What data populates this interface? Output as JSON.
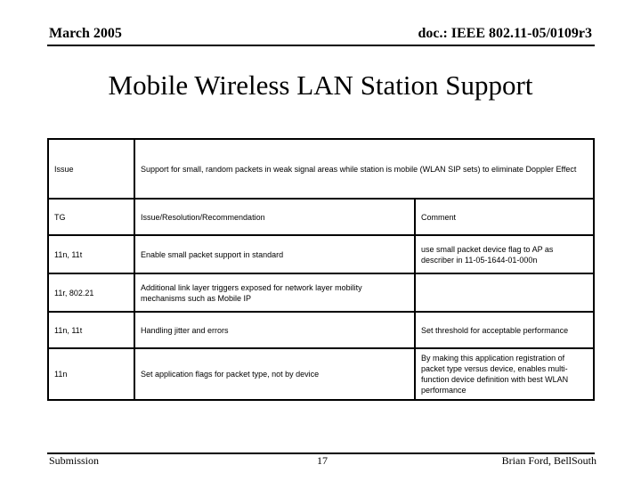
{
  "header": {
    "date": "March 2005",
    "doc_id": "doc.: IEEE 802.11-05/0109r3"
  },
  "title": "Mobile Wireless LAN Station Support",
  "table": {
    "issue_label": "Issue",
    "issue_text": "Support for small, random packets in weak signal areas while station is mobile (WLAN SIP sets) to eliminate Doppler Effect",
    "columns": [
      "TG",
      "Issue/Resolution/Recommendation",
      "Comment"
    ],
    "rows": [
      {
        "tg": "11n, 11t",
        "recommendation": "Enable small packet support in standard",
        "comment": "use small packet device flag to AP as describer in 11-05-1644-01-000n"
      },
      {
        "tg": "11r, 802.21",
        "recommendation": "Additional link layer triggers exposed for network layer mobility mechanisms such as Mobile IP",
        "comment": ""
      },
      {
        "tg": "11n, 11t",
        "recommendation": "Handling jitter and errors",
        "comment": "Set threshold for acceptable performance"
      },
      {
        "tg": "11n",
        "recommendation": "Set application flags for packet type, not by device",
        "comment": "By making this application registration of packet type versus device, enables multi-function device definition with best WLAN performance"
      }
    ]
  },
  "footer": {
    "left": "Submission",
    "page_number": "17",
    "author": "Brian Ford, BellSouth"
  }
}
